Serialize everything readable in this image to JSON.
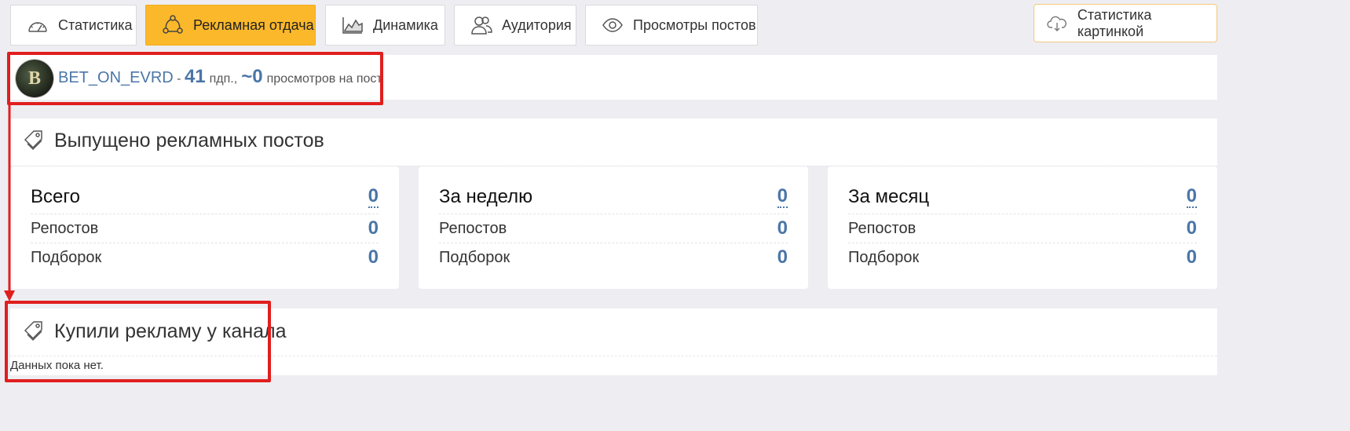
{
  "tabs": [
    {
      "label": "Статистика",
      "icon": "speedometer-icon"
    },
    {
      "label": "Рекламная отдача",
      "icon": "network-icon",
      "active": true
    },
    {
      "label": "Динамика",
      "icon": "area-chart-icon"
    },
    {
      "label": "Аудитория",
      "icon": "users-icon"
    },
    {
      "label": "Просмотры постов",
      "icon": "eye-icon"
    }
  ],
  "image_stats_button": {
    "label": "Статистика картинкой",
    "icon": "cloud-download-icon"
  },
  "channel": {
    "name": "BET_ON_EVRD",
    "dash": " - ",
    "subscribers": "41",
    "subscribers_unit": "пдп.,",
    "views": "~0",
    "views_unit": "просмотров на пост",
    "avatar_letter": "B"
  },
  "published": {
    "title": "Выпущено рекламных постов",
    "cards": [
      {
        "heading": "Всего",
        "total": "0",
        "reposts_label": "Репостов",
        "reposts": "0",
        "collections_label": "Подборок",
        "collections": "0"
      },
      {
        "heading": "За неделю",
        "total": "0",
        "reposts_label": "Репостов",
        "reposts": "0",
        "collections_label": "Подборок",
        "collections": "0"
      },
      {
        "heading": "За месяц",
        "total": "0",
        "reposts_label": "Репостов",
        "reposts": "0",
        "collections_label": "Подборок",
        "collections": "0"
      }
    ]
  },
  "bought": {
    "title": "Купили рекламу у канала",
    "empty_text": "Данных пока нет."
  },
  "colors": {
    "accent": "#fbb82a",
    "link": "#4a76a8",
    "highlight": "#e01e1e"
  }
}
